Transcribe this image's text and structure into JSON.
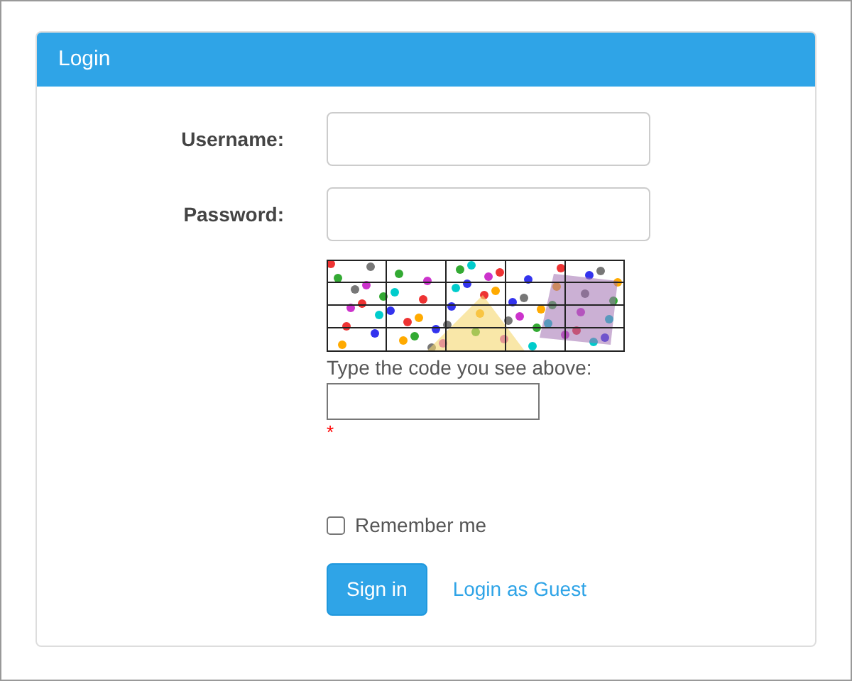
{
  "panel": {
    "title": "Login"
  },
  "fields": [
    {
      "label": "Username:"
    },
    {
      "label": "Password:"
    }
  ],
  "captcha": {
    "kind": "picture",
    "prompt": "Type the code you see above:",
    "required_mark": "*"
  },
  "remember": {
    "label": "Remember me",
    "checked": false
  },
  "buttons": {
    "sign_in": "Sign in",
    "guest": "Login as Guest"
  }
}
